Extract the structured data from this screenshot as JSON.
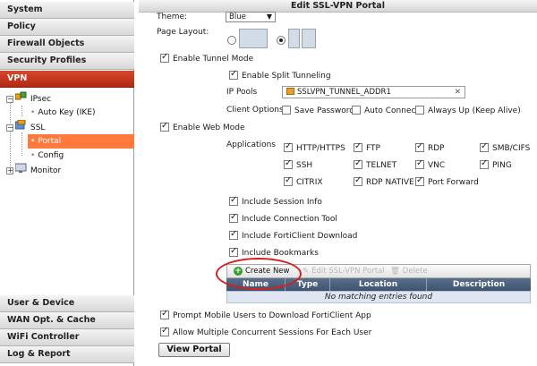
{
  "sidebar": {
    "top_sections": [
      {
        "label": "System"
      },
      {
        "label": "Policy"
      },
      {
        "label": "Firewall Objects"
      },
      {
        "label": "Security Profiles"
      },
      {
        "label": "VPN"
      }
    ],
    "tree": {
      "ipsec": "IPsec",
      "auto_key": "Auto Key (IKE)",
      "ssl": "SSL",
      "portal": "Portal",
      "config": "Config",
      "monitor": "Monitor"
    },
    "bottom_sections": [
      {
        "label": "User & Device"
      },
      {
        "label": "WAN Opt. & Cache"
      },
      {
        "label": "WiFi Controller"
      },
      {
        "label": "Log & Report"
      }
    ]
  },
  "main": {
    "title": "Edit SSL-VPN Portal",
    "theme_label": "Theme:",
    "theme_value": "Blue",
    "page_layout_label": "Page Layout:",
    "enable_tunnel_mode": "Enable Tunnel Mode",
    "enable_split_tunneling": "Enable Split Tunneling",
    "ip_pools_label": "IP Pools",
    "ip_pool_value": "SSLVPN_TUNNEL_ADDR1",
    "client_options_label": "Client Options",
    "save_password": "Save Password",
    "auto_connect": "Auto Connect",
    "always_up": "Always Up (Keep Alive)",
    "enable_web_mode": "Enable Web Mode",
    "applications_label": "Applications",
    "applications": [
      "HTTP/HTTPS",
      "FTP",
      "RDP",
      "SMB/CIFS",
      "SSH",
      "TELNET",
      "VNC",
      "PING",
      "CITRIX",
      "RDP NATIVE",
      "Port Forward"
    ],
    "include_session_info": "Include Session Info",
    "include_connection_tool": "Include Connection Tool",
    "include_forticlient_download": "Include FortiClient Download",
    "include_bookmarks": "Include Bookmarks",
    "create_new": "Create New",
    "edit_portal": "Edit SSL-VPN Portal",
    "delete": "Delete",
    "columns": [
      "Name",
      "Type",
      "Location",
      "Description"
    ],
    "empty_message": "No matching entries found",
    "prompt_mobile": "Prompt Mobile Users to Download FortiClient App",
    "allow_multiple": "Allow Multiple Concurrent Sessions For Each User",
    "view_portal": "View Portal"
  }
}
